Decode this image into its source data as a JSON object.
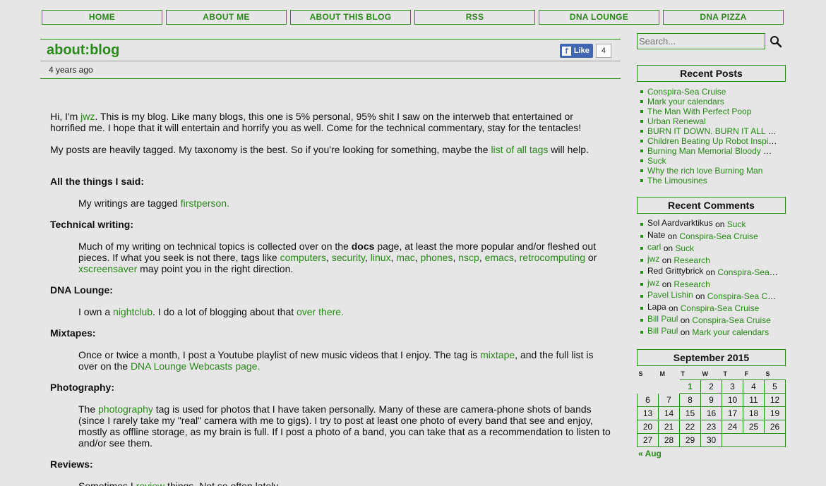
{
  "nav": [
    "HOME",
    "ABOUT ME",
    "ABOUT THIS BLOG",
    "RSS",
    "DNA LOUNGE",
    "DNA PIZZA"
  ],
  "post": {
    "title": "about:blog",
    "ago": "4 years ago",
    "fb_like": "Like",
    "fb_count": "4",
    "intro_a": "Hi, I'm ",
    "intro_link": "jwz",
    "intro_b": ". This is my blog. Like many blogs, this one is 5% personal, 95% shit I saw on the interweb that entertained or horrified me. I hope that it will entertain and horrify you as well. Come for the technical commentary, stay for the tentacles!",
    "tags_a": "My posts are heavily tagged. My taxonomy is the best. So if you're looking for something, maybe the ",
    "tags_link": "list of all tags",
    "tags_b": " will help.",
    "s1_head": "All the things I said:",
    "s1_a": "My writings are tagged ",
    "s1_link": "firstperson",
    "s1_b": ".",
    "s2_head": "Technical writing:",
    "s2_a": "Much of my writing on technical topics is collected over on the ",
    "s2_bold": "docs",
    "s2_b": " page, at least the more popular and/or fleshed out pieces. If what you seek is not there, tags like ",
    "s2_tags": [
      "computers",
      "security",
      "linux",
      "mac",
      "phones",
      "nscp",
      "emacs",
      "retrocomputing"
    ],
    "s2_or": " or ",
    "s2_last": "xscreensaver",
    "s2_c": " may point you in the right direction.",
    "s3_head": "DNA Lounge:",
    "s3_a": "I own a ",
    "s3_link1": "nightclub",
    "s3_b": ". I do a lot of blogging about that ",
    "s3_link2": "over there",
    "s3_c": ".",
    "s4_head": "Mixtapes:",
    "s4_a": "Once or twice a month, I post a Youtube playlist of new music videos that I enjoy. The tag is ",
    "s4_link1": "mixtape",
    "s4_b": ", and the full list is over on the ",
    "s4_link2": "DNA Lounge Webcasts page",
    "s4_c": ".",
    "s5_head": "Photography:",
    "s5_a": "The ",
    "s5_link": "photography",
    "s5_b": " tag is used for photos that I have taken personally. Many of these are camera-phone shots of bands (since I rarely take my \"real\" camera with me to gigs). I try to post at least one photo of every band that see and enjoy, mostly as offline storage, as my brain is full. If I post a photo of a band, you can take that as a recommendation to listen to and/or see them.",
    "s6_head": "Reviews:",
    "s6_a": "Sometimes I ",
    "s6_link": "review",
    "s6_b": " things. Not so often lately."
  },
  "sidebar": {
    "search_placeholder": "Search...",
    "recent_posts_head": "Recent Posts",
    "recent_posts": [
      "Conspira-Sea Cruise",
      "Mark your calendars",
      "The Man With Perfect Poop",
      "Urban Renewal",
      "BURN IT DOWN. BURN IT ALL DOWN.",
      "Children Beating Up Robot Inspire New Escape Maneuver",
      "Burning Man Memorial Bloody Mary",
      "Suck",
      "Why the rich love Burning Man",
      "The Limousines"
    ],
    "recent_comments_head": "Recent Comments",
    "on": "on",
    "recent_comments": [
      {
        "who": "Sol Aardvarktikus",
        "link": false,
        "post": "Suck"
      },
      {
        "who": "Nate",
        "link": false,
        "post": "Conspira-Sea Cruise"
      },
      {
        "who": "carl",
        "link": true,
        "post": "Suck"
      },
      {
        "who": "jwz",
        "link": true,
        "post": "Research"
      },
      {
        "who": "Red Grittybrick",
        "link": false,
        "post": "Conspira-Sea Cruise"
      },
      {
        "who": "jwz",
        "link": true,
        "post": "Research"
      },
      {
        "who": "Pavel Lishin",
        "link": true,
        "post": "Conspira-Sea Cruise"
      },
      {
        "who": "Lapa",
        "link": false,
        "post": "Conspira-Sea Cruise"
      },
      {
        "who": "Bill Paul",
        "link": true,
        "post": "Conspira-Sea Cruise"
      },
      {
        "who": "Bill Paul",
        "link": true,
        "post": "Mark your calendars"
      }
    ],
    "calendar_head": "September 2015",
    "weekdays": [
      "S",
      "M",
      "T",
      "W",
      "T",
      "F",
      "S"
    ],
    "weeks": [
      [
        "",
        "",
        "1",
        "2",
        "3",
        "4",
        "5"
      ],
      [
        "6",
        "7",
        "8",
        "9",
        "10",
        "11",
        "12"
      ],
      [
        "13",
        "14",
        "15",
        "16",
        "17",
        "18",
        "19"
      ],
      [
        "20",
        "21",
        "22",
        "23",
        "24",
        "25",
        "26"
      ],
      [
        "27",
        "28",
        "29",
        "30",
        "",
        "",
        ""
      ]
    ],
    "today": "1",
    "prev_month": "« Aug"
  }
}
